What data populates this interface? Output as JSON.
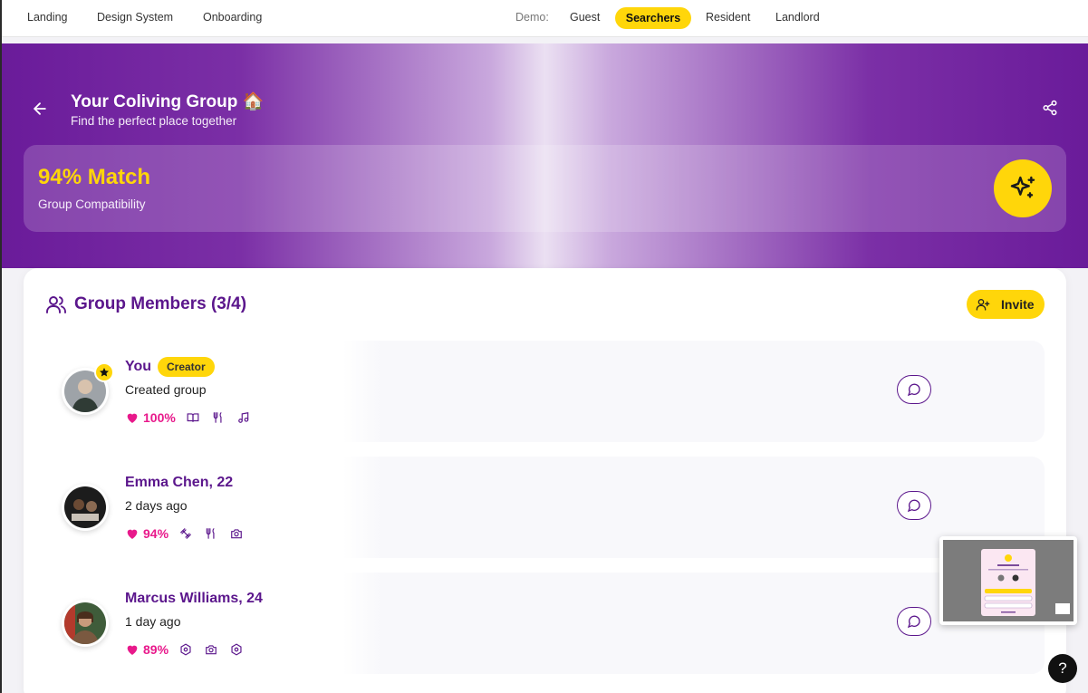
{
  "nav": {
    "links": [
      "Landing",
      "Design System",
      "Onboarding"
    ],
    "demo_label": "Demo:",
    "roles": [
      "Guest",
      "Searchers",
      "Resident",
      "Landlord"
    ],
    "active_role": "Searchers"
  },
  "hero": {
    "title": "Your Coliving Group 🏠",
    "subtitle": "Find the perfect place together"
  },
  "match": {
    "value": "94% Match",
    "label": "Group Compatibility"
  },
  "members": {
    "title": "Group Members (3/4)",
    "invite_label": "Invite",
    "list": [
      {
        "name": "You",
        "badge": "Creator",
        "status": "Created group",
        "compat": "100%",
        "interests": [
          "book-icon",
          "utensils-icon",
          "music-icon"
        ]
      },
      {
        "name": "Emma Chen, 22",
        "status": "2 days ago",
        "compat": "94%",
        "interests": [
          "dumbbell-icon",
          "utensils-icon",
          "camera-icon"
        ]
      },
      {
        "name": "Marcus Williams, 24",
        "status": "1 day ago",
        "compat": "89%",
        "interests": [
          "settings-icon",
          "camera-icon",
          "settings-icon"
        ]
      }
    ]
  },
  "help": {
    "label": "?"
  },
  "colors": {
    "accent_yellow": "#ffd60a",
    "brand_purple": "#5b168c",
    "compat_pink": "#e8198b"
  }
}
